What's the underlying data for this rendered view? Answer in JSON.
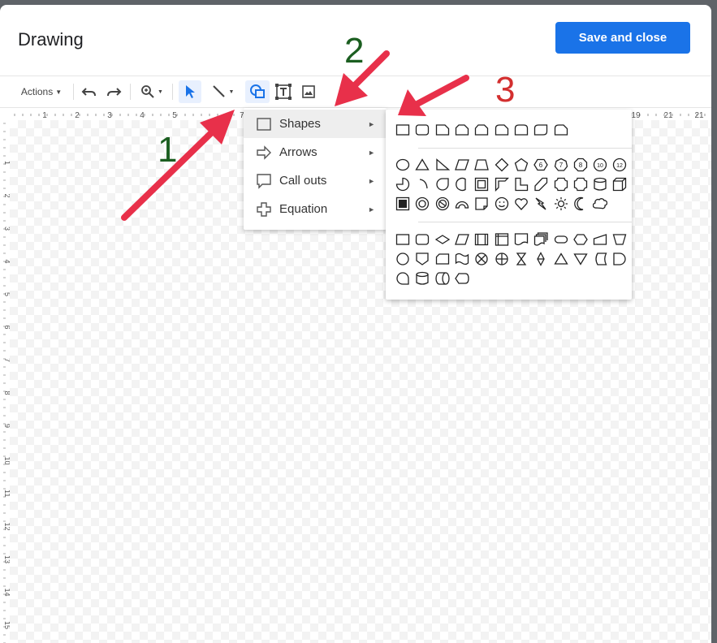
{
  "dialog": {
    "title": "Drawing",
    "save_label": "Save and close"
  },
  "toolbar": {
    "actions_label": "Actions",
    "icons": [
      "undo-icon",
      "redo-icon",
      "zoom-icon",
      "select-icon",
      "line-icon",
      "shape-icon",
      "text-box-icon",
      "image-icon"
    ]
  },
  "ruler": {
    "top_numbers": [
      "1",
      "2",
      "3",
      "4",
      "5",
      "7",
      "19",
      "21",
      "21"
    ],
    "side_numbers": [
      "1",
      "2",
      "3",
      "4",
      "5",
      "6",
      "7",
      "8",
      "9",
      "10",
      "11",
      "12",
      "13",
      "14",
      "15"
    ]
  },
  "shape_menu": {
    "items": [
      {
        "label": "Shapes",
        "icon": "square-icon",
        "highlighted": true
      },
      {
        "label": "Arrows",
        "icon": "arrow-right-icon"
      },
      {
        "label": "Call outs",
        "icon": "callout-icon"
      },
      {
        "label": "Equation",
        "icon": "plus-icon"
      }
    ]
  },
  "annotations": {
    "one": "1",
    "two": "2",
    "three": "3"
  },
  "colors": {
    "primary": "#1a73e8",
    "arrow": "#e8304a",
    "green_label": "#1b5e20",
    "red_label": "#d32f2f"
  }
}
